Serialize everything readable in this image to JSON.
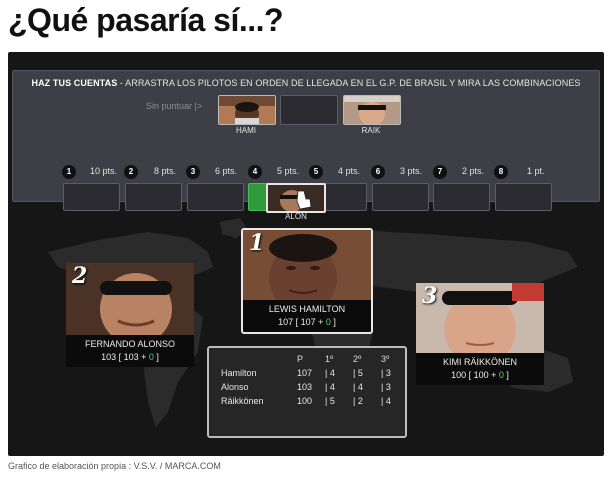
{
  "page": {
    "title": "¿Qué pasaría sí...?"
  },
  "panel": {
    "instructions_bold": "HAZ TUS CUENTAS",
    "instructions_rest": " - ARRASTRA LOS PILOTOS EN ORDEN DE LLEGADA EN EL G.P. DE BRASIL Y MIRA LAS COMBINACIONES",
    "unscored_label": "Sin puntuar |>",
    "pool": [
      {
        "label": "HAMI"
      },
      {
        "label": ""
      },
      {
        "label": "RAIK"
      }
    ],
    "positions": [
      {
        "num": "1",
        "pts": "10 pts."
      },
      {
        "num": "2",
        "pts": "8 pts."
      },
      {
        "num": "3",
        "pts": "6 pts."
      },
      {
        "num": "4",
        "pts": "5 pts."
      },
      {
        "num": "5",
        "pts": "4 pts."
      },
      {
        "num": "6",
        "pts": "3 pts."
      },
      {
        "num": "7",
        "pts": "2 pts."
      },
      {
        "num": "8",
        "pts": "1 pt."
      }
    ],
    "active_slot": 4,
    "dragging": {
      "label": "ALON"
    }
  },
  "cards": {
    "first": {
      "rank": "1",
      "name": "LEWIS HAMILTON",
      "total": "107",
      "base": "107",
      "plus": "0"
    },
    "second": {
      "rank": "2",
      "name": "FERNANDO ALONSO",
      "total": "103",
      "base": "103",
      "plus": "0"
    },
    "third": {
      "rank": "3",
      "name": "KIMI RÄIKKÖNEN",
      "total": "100",
      "base": "100",
      "plus": "0"
    }
  },
  "stats": {
    "headers": [
      "P",
      "1º",
      "2º",
      "3º"
    ],
    "rows": [
      {
        "name": "Hamilton",
        "p": "107",
        "first": "| 4",
        "second": "| 5",
        "third": "| 3"
      },
      {
        "name": "Alonso",
        "p": "103",
        "first": "| 4",
        "second": "| 4",
        "third": "| 3"
      },
      {
        "name": "Räikkönen",
        "p": "100",
        "first": "| 5",
        "second": "| 2",
        "third": "| 4"
      }
    ]
  },
  "credit": "Grafico de elaboración propia : V.S.V. / MARCA.COM",
  "colors": {
    "active_slot": "#2e9a3c",
    "plus_points": "#5fd36a",
    "widget_bg": "#161616"
  }
}
